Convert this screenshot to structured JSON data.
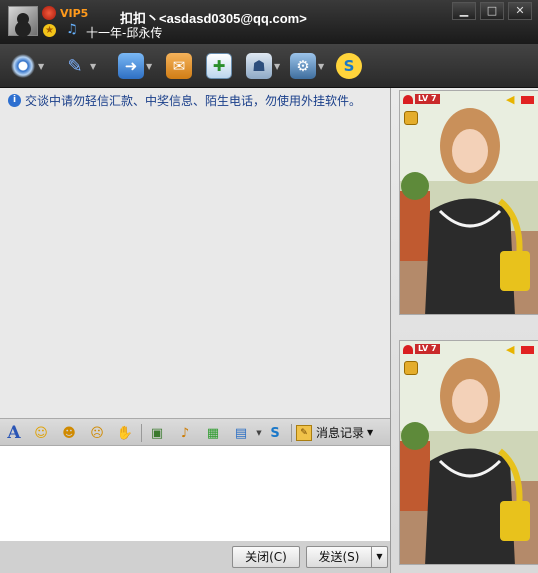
{
  "titlebar": {
    "vip_label": "VIP5",
    "contact_name": "扣扣丶<asdasd0305@qq.com>",
    "signature": "十一年-邱永传",
    "minimize": "▁",
    "maximize": "□",
    "close": "✕"
  },
  "toolbar": {
    "items": [
      {
        "icon": "video-call-icon"
      },
      {
        "icon": "voice-call-icon"
      },
      {
        "icon": "send-file-icon"
      },
      {
        "icon": "send-mail-icon"
      },
      {
        "icon": "create-discussion-icon"
      },
      {
        "icon": "remote-assistance-icon"
      },
      {
        "icon": "app-settings-icon"
      },
      {
        "icon": "soso-icon"
      }
    ]
  },
  "chat": {
    "notice": "交谈中请勿轻信汇款、中奖信息、陌生电话，勿使用外挂软件。"
  },
  "format_bar": {
    "history_label": "消息记录"
  },
  "bottom_bar": {
    "close_label": "关闭(C)",
    "send_label": "发送(S)"
  },
  "right_panel": {
    "level_badge": "LV 7"
  },
  "colors": {
    "title_bg": "#1f1f1f",
    "chat_bg": "#e9e9e9",
    "notice_text": "#1a3f8a",
    "vip": "#ff9a1c"
  }
}
